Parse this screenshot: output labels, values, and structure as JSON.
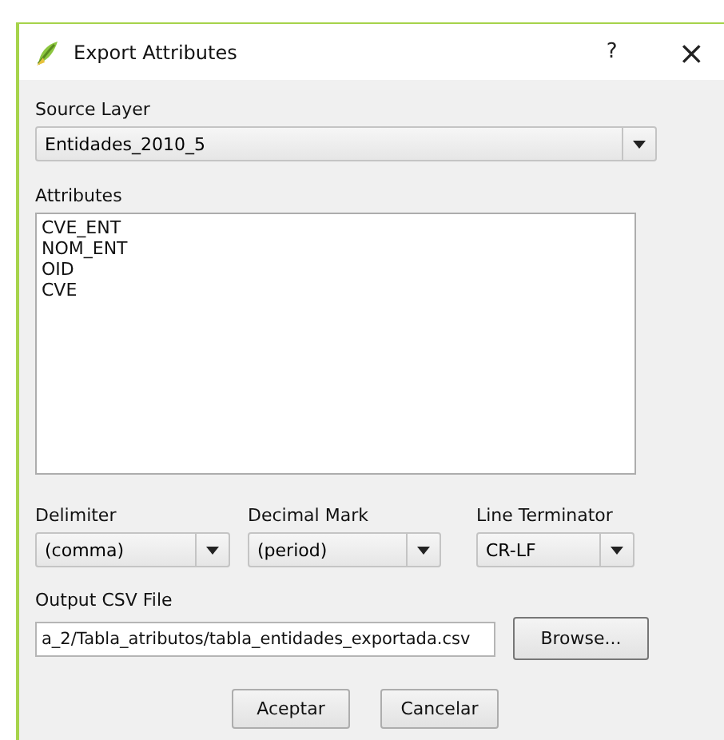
{
  "window": {
    "title": "Export Attributes",
    "help": "?",
    "close": "×"
  },
  "source_layer": {
    "label": "Source Layer",
    "value": "Entidades_2010_5"
  },
  "attributes": {
    "label": "Attributes",
    "items": [
      "CVE_ENT",
      "NOM_ENT",
      "OID",
      "CVE"
    ]
  },
  "options": [
    {
      "label": "Delimiter",
      "value": "(comma)"
    },
    {
      "label": "Decimal Mark",
      "value": "(period)"
    },
    {
      "label": "Line Terminator",
      "value": "CR-LF"
    }
  ],
  "output": {
    "label": "Output CSV File",
    "value": "a_2/Tabla_atributos/tabla_entidades_exportada.csv",
    "browse": "Browse..."
  },
  "buttons": [
    "Aceptar",
    "Cancelar"
  ]
}
